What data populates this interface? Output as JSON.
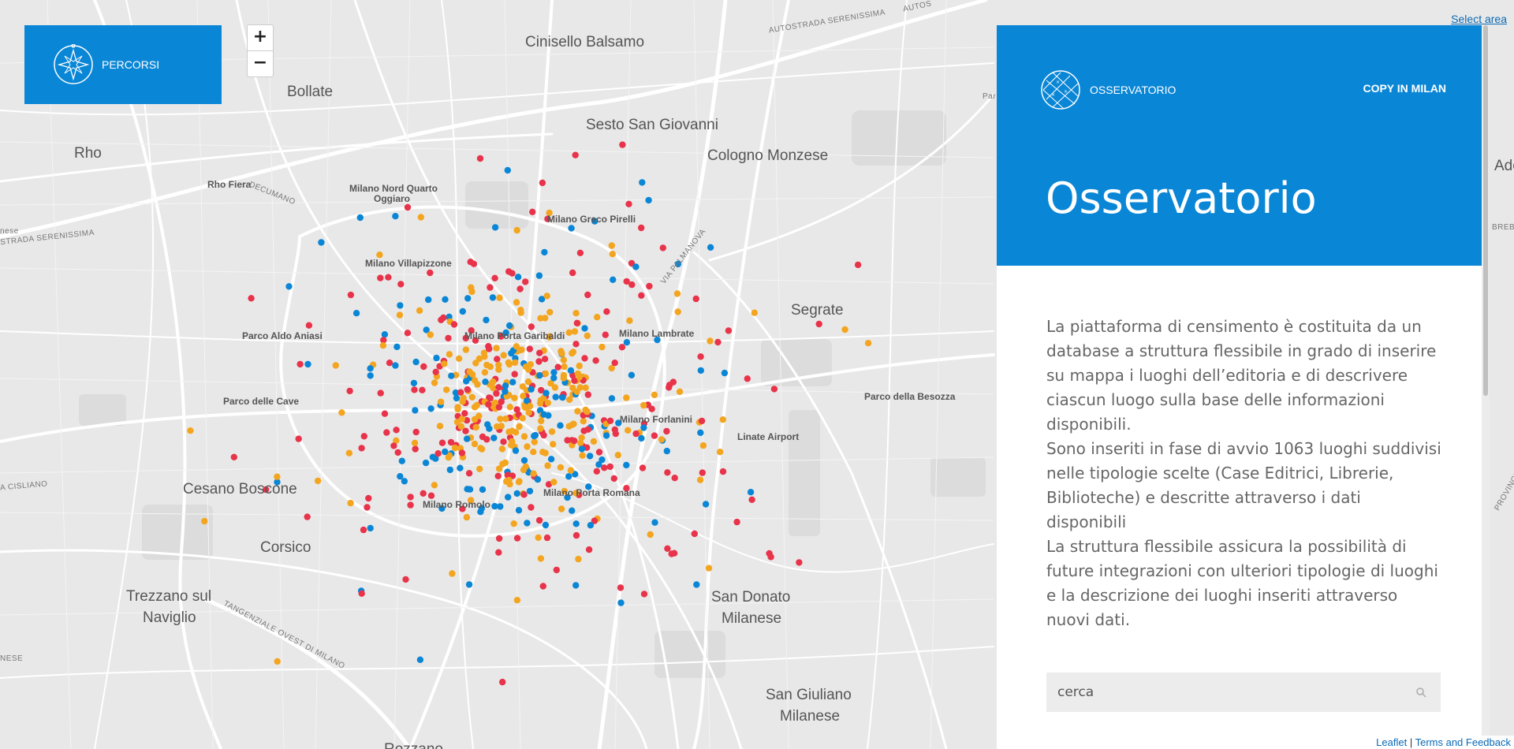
{
  "percorsi": {
    "label": "PERCORSI",
    "logo_icon": "compass-icon"
  },
  "zoom": {
    "in_label": "+",
    "out_label": "−"
  },
  "select_area": "Select area",
  "panel": {
    "brand": "OSSERVATORIO",
    "copy_link": "COPY IN MILAN",
    "title": "Osservatorio",
    "paragraphs": [
      "La piattaforma di censimento è costituita da un database a struttura flessibile in grado di inserire su mappa i luoghi dell’editoria e di descrivere ciascun luogo sulla base delle informazioni disponibili.",
      "Sono inseriti in fase di avvio 1063 luoghi suddivisi nelle tipologie scelte (Case Editrici, Librerie, Biblioteche) e descritte attraverso i dati disponibili",
      "La struttura flessibile assicura la possibilità di future integrazioni con ulteriori tipologie di luoghi e la descrizione dei luoghi inseriti attraverso nuovi dati."
    ],
    "search_placeholder": "cerca",
    "search_icon": "search-icon"
  },
  "attribution": {
    "leaflet": "Leaflet",
    "separator": " | ",
    "terms": "Terms and Feedback"
  },
  "places": {
    "cinisello": "Cinisello Balsamo",
    "bollate": "Bollate",
    "sesto": "Sesto San Giovanni",
    "rho": "Rho",
    "cologno": "Cologno Monzese",
    "rho_fiera": "Rho Fiera",
    "nord_quarto_1": "Milano Nord Quarto",
    "nord_quarto_2": "Oggiaro",
    "greco": "Milano Greco Pirelli",
    "villapizzone": "Milano Villapizzone",
    "segrate": "Segrate",
    "aldo_aniasi": "Parco Aldo Aniasi",
    "garibaldi": "Milano Porta Garibaldi",
    "lambrate": "Milano Lambrate",
    "cave": "Parco delle Cave",
    "besozza": "Parco della Besozza",
    "forlanini": "Milano Forlanini",
    "linate": "Linate Airport",
    "cesano": "Cesano Boscone",
    "romolo": "Milano Romolo",
    "porta_romana": "Milano Porta Romana",
    "corsico": "Corsico",
    "trezzano_1": "Trezzano sul",
    "trezzano_2": "Naviglio",
    "san_donato_1": "San Donato",
    "san_donato_2": "Milanese",
    "san_giuliano_1": "San Giuliano",
    "san_giuliano_2": "Milanese",
    "rozzano": "Rozzano",
    "road_serenissima": "AUTOSTRADA SERENISSIMA",
    "road_autos": "AUTOS",
    "road_decumano": "DECUMANO",
    "road_serenissima_w": "STRADA SERENISSIMA",
    "road_nese": "nese",
    "road_palmanova": "VIA PALMANOVA",
    "road_tangenziale": "TANGENZIALE OVEST DI MILANO",
    "road_cisliano": "A CISLIANO",
    "road_nese2": "NESE",
    "road_par": "Par",
    "road_ado": "Ado",
    "road_brebi": "BREBI",
    "road_provinciale": "PROVINCIALE"
  },
  "colors": {
    "red": "#e8334a",
    "blue": "#0a86d6",
    "orange": "#f3a51f",
    "panel": "#0a86d6"
  }
}
